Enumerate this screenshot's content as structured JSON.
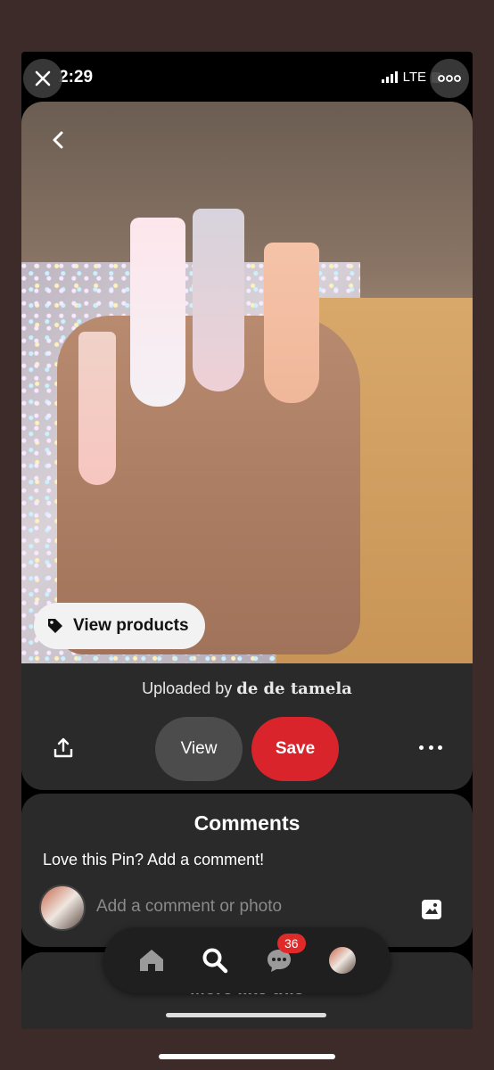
{
  "status_bar": {
    "time": "2:29",
    "network": "LTE"
  },
  "pin": {
    "view_products_label": "View products",
    "uploaded_prefix": "Uploaded by",
    "uploader": "de de tamela",
    "view_label": "View",
    "save_label": "Save"
  },
  "comments": {
    "title": "Comments",
    "prompt": "Love this Pin? Add a comment!",
    "placeholder": "Add a comment or photo"
  },
  "more_like_this": {
    "title": "More like this"
  },
  "tabbar": {
    "notifications_badge": "36"
  },
  "colors": {
    "save": "#d9242b",
    "card": "#2a2a2a",
    "frame": "#3d2b29"
  },
  "icons": [
    "close-icon",
    "more-icon",
    "back-icon",
    "tag-icon",
    "share-icon",
    "dots-icon",
    "photo-icon",
    "home-icon",
    "search-icon",
    "chat-icon"
  ]
}
